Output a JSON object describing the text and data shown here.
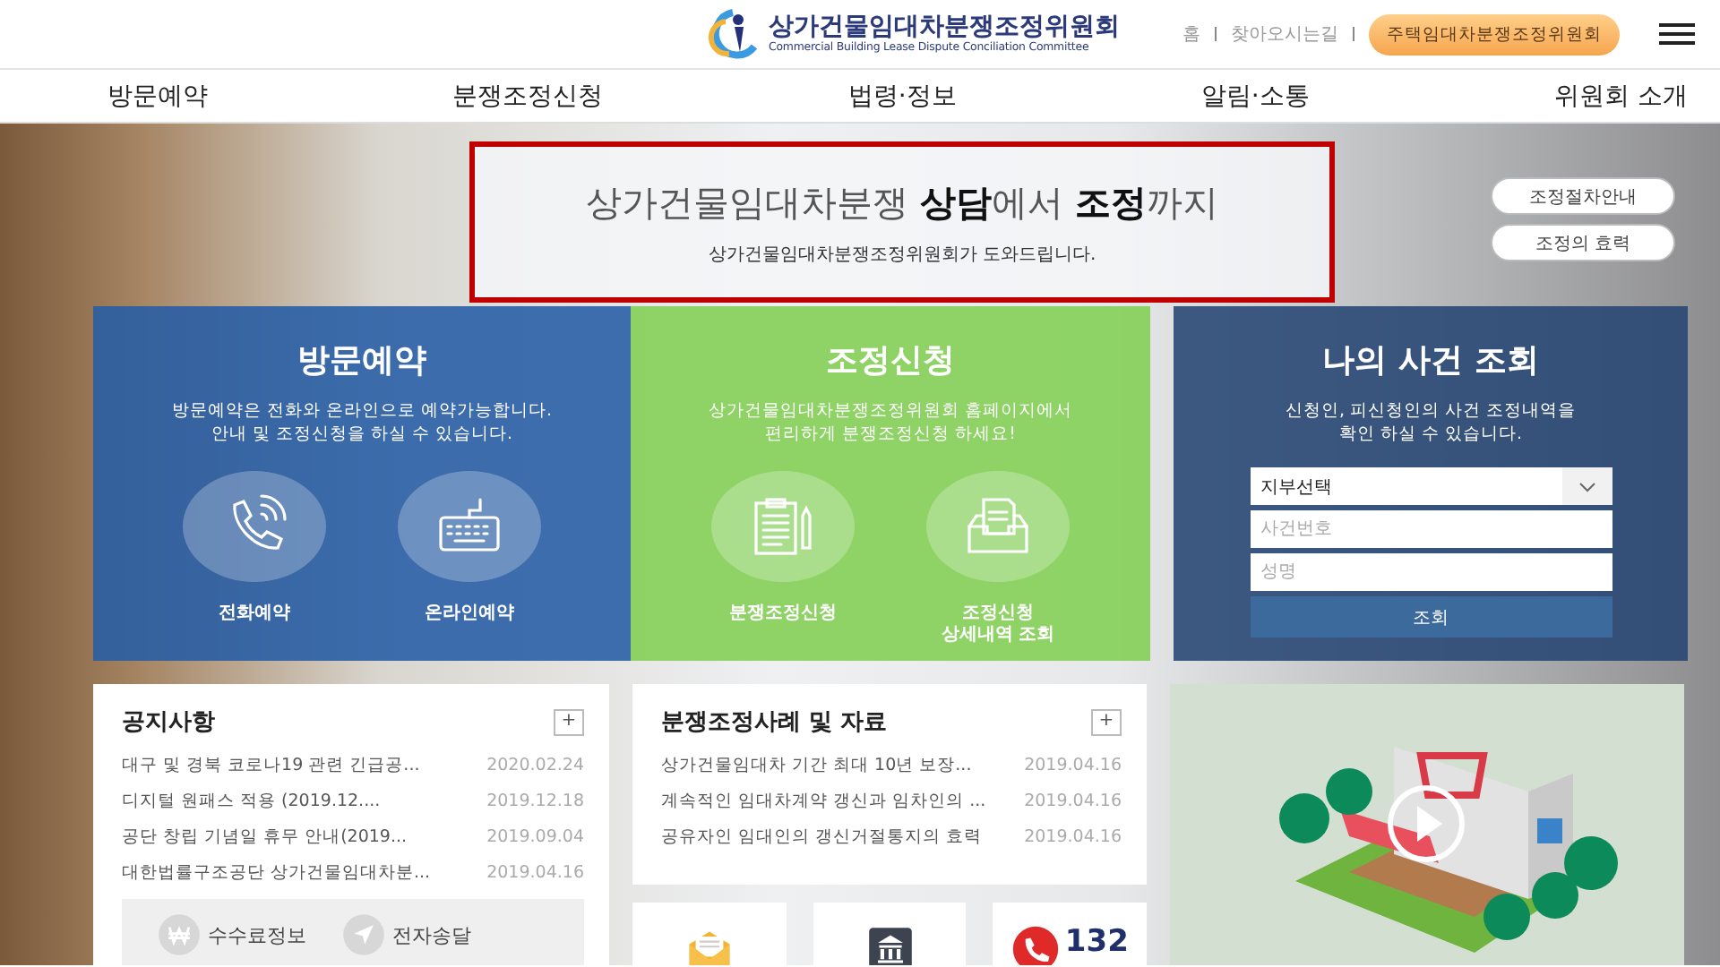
{
  "header": {
    "logo_title": "상가건물임대차분쟁조정위원회",
    "logo_subtitle": "Commercial Building Lease Dispute Conciliation Committee",
    "util_links": [
      "홈",
      "찾아오시는길"
    ],
    "highlight_button": "주택임대차분쟁조정위원회"
  },
  "nav": [
    "방문예약",
    "분쟁조정신청",
    "법령·정보",
    "알림·소통",
    "위원회 소개"
  ],
  "banner": {
    "headline": "상가건물임대차분쟁 **상담**에서 **조정**까지",
    "subline": "상가건물임대차분쟁조정위원회가 도와드립니다."
  },
  "side_buttons": [
    "조정절차안내",
    "조정의 효력"
  ],
  "visit_card": {
    "title": "방문예약",
    "description": "방문예약은 전화와 온라인으로 예약가능합니다.\n안내 및 조정신청을 하실 수 있습니다.",
    "actions": [
      {
        "label": "전화예약"
      },
      {
        "label": "온라인예약"
      }
    ]
  },
  "apply_card": {
    "title": "조정신청",
    "description": "상가건물임대차분쟁조정위원회 홈페이지에서\n편리하게 분쟁조정신청 하세요!",
    "actions": [
      {
        "label": "분쟁조정신청"
      },
      {
        "label": "조정신청\n상세내역 조회"
      }
    ]
  },
  "lookup_card": {
    "title": "나의 사건 조회",
    "description": "신청인, 피신청인의 사건 조정내역을\n확인 하실 수 있습니다.",
    "select": {
      "value": "지부선택"
    },
    "fields": [
      {
        "placeholder": "사건번호"
      },
      {
        "placeholder": "성명"
      }
    ],
    "submit": "조회"
  },
  "notices": {
    "title": "공지사항",
    "more": "+",
    "items": [
      {
        "title": "대구 및 경북 코로나19 관련 긴급공...",
        "date": "2020.02.24"
      },
      {
        "title": "디지털 원패스 적용 (2019.12....",
        "date": "2019.12.18"
      },
      {
        "title": "공단 창립 기념일 휴무 안내(2019...",
        "date": "2019.09.04"
      },
      {
        "title": "대한법률구조공단 상가건물임대차분...",
        "date": "2019.04.16"
      }
    ]
  },
  "quick_links": [
    {
      "label": "수수료정보"
    },
    {
      "label": "전자송달"
    }
  ],
  "cases": {
    "title": "분쟁조정사례 및 자료",
    "more": "+",
    "items": [
      {
        "title": "상가건물임대차 기간 최대 10년 보장...",
        "date": "2019.04.16"
      },
      {
        "title": "계속적인 임대차계약 갱신과 임차인의 ...",
        "date": "2019.04.16"
      },
      {
        "title": "공유자인 임대인의 갱신거절통지의 효력",
        "date": "2019.04.16"
      }
    ]
  },
  "hotline_tile": {
    "label": "132"
  }
}
